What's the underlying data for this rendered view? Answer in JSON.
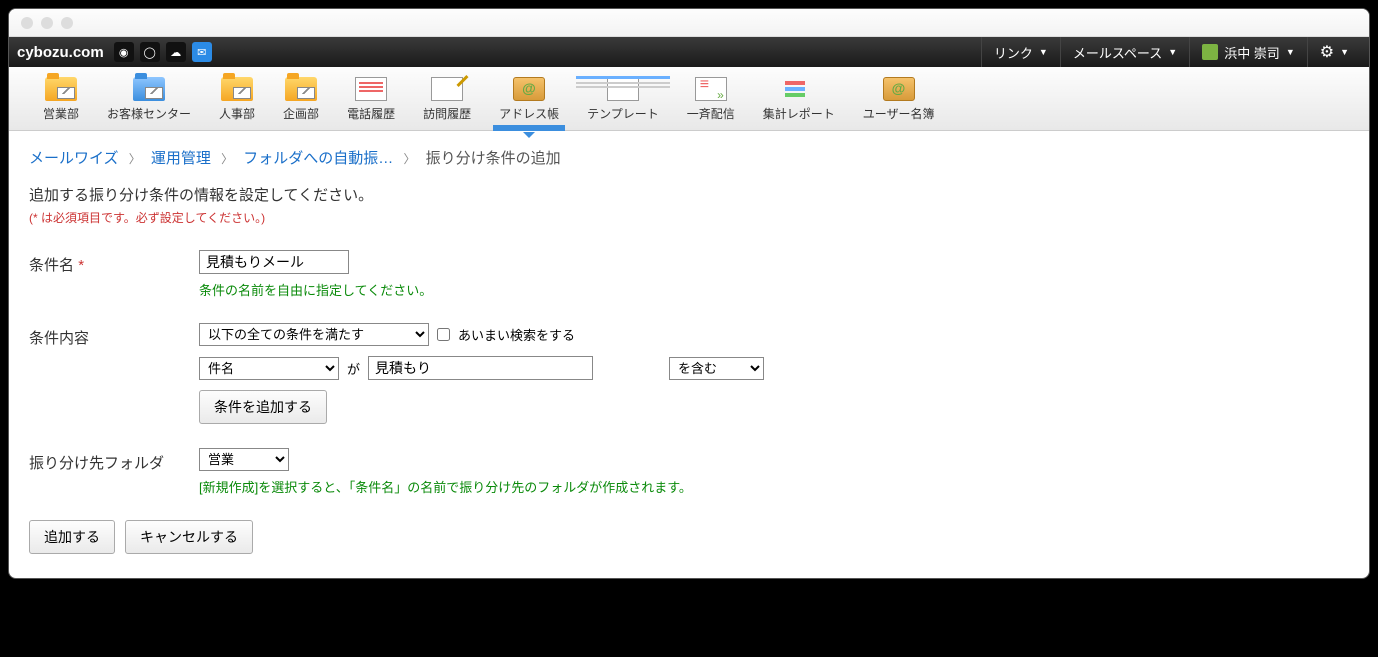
{
  "brand": "cybozu.com",
  "topright": {
    "link": "リンク",
    "mailspace": "メールスペース",
    "user": "浜中 崇司"
  },
  "toolbar": [
    {
      "label": "営業部"
    },
    {
      "label": "お客様センター"
    },
    {
      "label": "人事部"
    },
    {
      "label": "企画部"
    },
    {
      "label": "電話履歴"
    },
    {
      "label": "訪問履歴"
    },
    {
      "label": "アドレス帳"
    },
    {
      "label": "テンプレート"
    },
    {
      "label": "一斉配信"
    },
    {
      "label": "集計レポート"
    },
    {
      "label": "ユーザー名簿"
    }
  ],
  "breadcrumb": {
    "a": "メールワイズ",
    "b": "運用管理",
    "c": "フォルダへの自動振…",
    "cur": "振り分け条件の追加"
  },
  "lead": "追加する振り分け条件の情報を設定してください。",
  "note": "(* は必須項目です。必ず設定してください。)",
  "labels": {
    "name": "条件名",
    "content": "条件内容",
    "folder": "振り分け先フォルダ"
  },
  "form": {
    "name_value": "見積もりメール",
    "name_hint": "条件の名前を自由に指定してください。",
    "match_select": "以下の全ての条件を満たす",
    "fuzzy_label": "あいまい検索をする",
    "field_select": "件名",
    "ga": "が",
    "keyword_value": "見積もり",
    "op_select": "を含む",
    "add_cond_btn": "条件を追加する",
    "folder_select": "営業",
    "folder_hint": "[新規作成]を選択すると、「条件名」の名前で振り分け先のフォルダが作成されます。"
  },
  "actions": {
    "submit": "追加する",
    "cancel": "キャンセルする"
  }
}
